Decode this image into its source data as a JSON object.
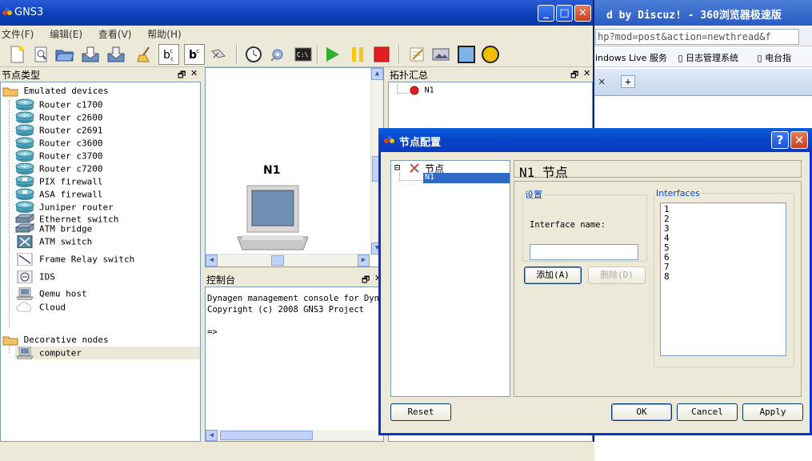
{
  "browser": {
    "title": "d by Discuz! - 360浏览器极速版",
    "url": "hp?mod=post&action=newthread&f",
    "favorites": [
      "indows Live 服务",
      "日志管理系统",
      "电台指"
    ],
    "tab_close": "✕",
    "tab_add": "+"
  },
  "app": {
    "title": "GNS3",
    "window_buttons": {
      "minimize": "_",
      "maximize": "□",
      "close": "✕"
    }
  },
  "menu": [
    {
      "label": "文件(F)"
    },
    {
      "label": "编辑(E)"
    },
    {
      "label": "查看(V)"
    },
    {
      "label": "帮助(H)"
    }
  ],
  "toolbar": {
    "icons": [
      "new-file",
      "open-snapshot",
      "open-folder",
      "save",
      "save-as",
      "clear",
      "show-interface-labels",
      "show-hostnames",
      "link",
      "timer",
      "preferences",
      "terminal",
      "start",
      "pause",
      "stop",
      "note",
      "image",
      "rectangle",
      "ellipse"
    ],
    "colors": {
      "start": "#2db02d",
      "pause": "#f5c518",
      "stop": "#e02020",
      "rectangle": "#7fb2e8",
      "ellipse": "#f0c000"
    }
  },
  "nodetypes": {
    "title": "节点类型",
    "dock_buttons": {
      "float": "🗗",
      "close": "✕"
    },
    "categories": [
      {
        "label": "Emulated devices",
        "items": [
          {
            "label": "Router c1700",
            "icon": "router"
          },
          {
            "label": "Router c2600",
            "icon": "router"
          },
          {
            "label": "Router c2691",
            "icon": "router"
          },
          {
            "label": "Router c3600",
            "icon": "router"
          },
          {
            "label": "Router c3700",
            "icon": "router"
          },
          {
            "label": "Router c7200",
            "icon": "router"
          },
          {
            "label": "PIX firewall",
            "icon": "firewall"
          },
          {
            "label": "ASA firewall",
            "icon": "firewall"
          },
          {
            "label": "Juniper router",
            "icon": "router"
          },
          {
            "label": "Ethernet switch",
            "icon": "switch"
          },
          {
            "label": "ATM bridge",
            "icon": "switch"
          },
          {
            "label": "ATM switch",
            "icon": "atm"
          },
          {
            "label": "Frame Relay switch",
            "icon": "frame-relay"
          },
          {
            "label": "IDS",
            "icon": "ids"
          },
          {
            "label": "Qemu host",
            "icon": "computer"
          },
          {
            "label": "Cloud",
            "icon": "cloud"
          }
        ]
      },
      {
        "label": "Decorative nodes",
        "items": [
          {
            "label": "computer",
            "icon": "computer"
          }
        ]
      }
    ]
  },
  "scene": {
    "node_label": "N1",
    "scroll_up": "▲",
    "scroll_down": "▼",
    "scroll_left": "◀",
    "scroll_right": "▶"
  },
  "topology": {
    "title": "拓扑汇总",
    "dock_buttons": {
      "float": "🗗",
      "close": "✕"
    },
    "nodes": [
      {
        "label": "N1",
        "status_color": "#e02020"
      }
    ]
  },
  "console": {
    "title": "控制台",
    "dock_buttons": {
      "float": "🗗",
      "close": "✕"
    },
    "lines": "Dynagen management console for Dynamips\nCopyright (c) 2008 GNS3 Project\n\n=>"
  },
  "dialog": {
    "title": "节点配置",
    "help_button": "?",
    "close_button": "✕",
    "tree": {
      "root": "节点",
      "expander": "⊟",
      "children": [
        "N1"
      ]
    },
    "page_title": "N1 节点",
    "settings_group": "设置",
    "interface_name_label": "Interface name:",
    "interface_name_value": "",
    "add_button": "添加(A)",
    "delete_button": "删除(D)",
    "interfaces_group": "Interfaces",
    "interfaces": [
      "1",
      "2",
      "3",
      "4",
      "5",
      "6",
      "7",
      "8"
    ],
    "reset_button": "Reset",
    "ok_button": "OK",
    "cancel_button": "Cancel",
    "apply_button": "Apply"
  }
}
